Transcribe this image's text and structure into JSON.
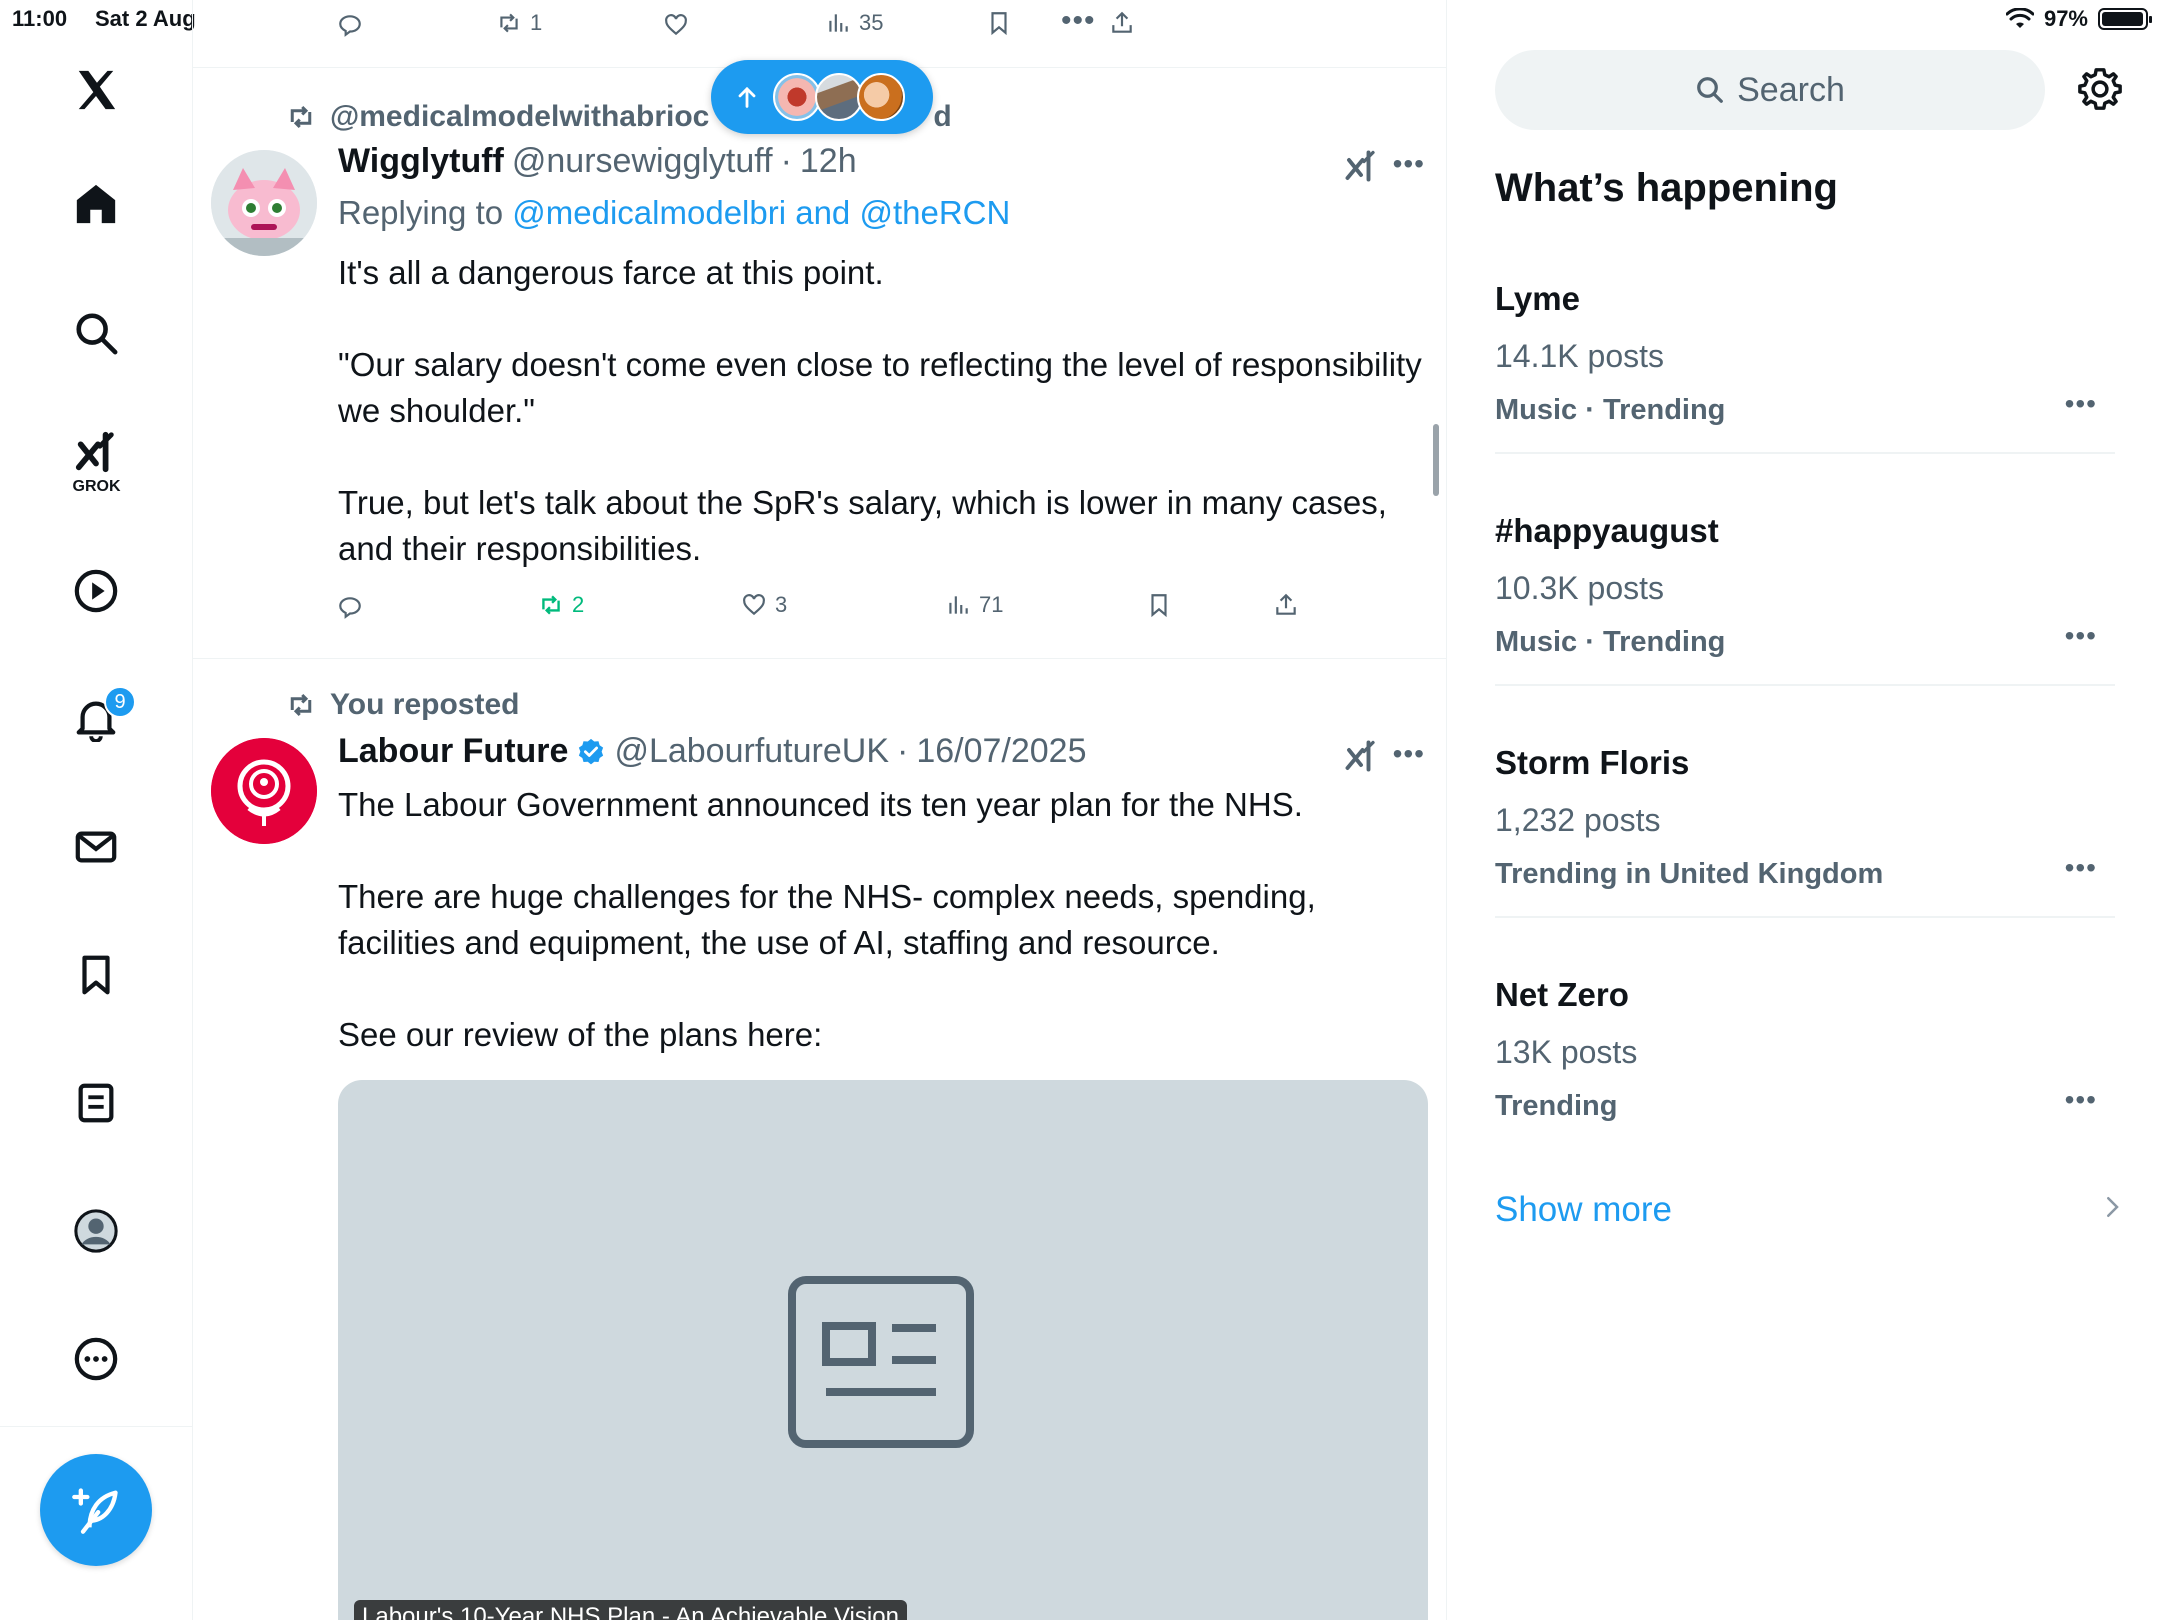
{
  "status_bar": {
    "time": "11:00",
    "date": "Sat 2 Aug",
    "battery": "97%",
    "battery_level": 0.97
  },
  "nav": {
    "grok_label": "GROK",
    "notifications_badge": "9",
    "items": [
      "x-logo",
      "home-icon",
      "search-icon",
      "grok-icon",
      "video-icon",
      "bell-icon",
      "mail-icon",
      "bookmark-icon",
      "lists-icon",
      "profile-icon",
      "more-icon"
    ]
  },
  "top_actions": {
    "reposts": "1",
    "views": "35"
  },
  "tweet1": {
    "repost_by": "@medicalmodelwithabrioc",
    "repost_suffix": "d",
    "name": "Wigglytuff",
    "handle": "@nursewigglytuff",
    "time": "12h",
    "replying_prefix": "Replying to",
    "replying_handles": "@medicalmodelbri and @theRCN",
    "body": [
      "It's all a dangerous farce at this point.",
      "\"Our salary doesn't come even close to reflecting the level of responsibility we shoulder.\"",
      "True, but let's talk about the SpR's salary, which is lower in many cases, and their responsibilities."
    ],
    "reposts": "2",
    "likes": "3",
    "views": "71"
  },
  "tweet2": {
    "repost_label": "You reposted",
    "name": "Labour Future",
    "handle": "@LabourfutureUK",
    "time": "16/07/2025",
    "body": [
      "The Labour Government announced its ten year plan for the NHS.",
      "There are huge challenges for the NHS- complex needs, spending, facilities and equipment, the use of AI, staffing and resource.",
      "See our review of the plans here:"
    ],
    "card_caption": "Labour's 10-Year NHS Plan - An Achievable Vision"
  },
  "sidebar": {
    "search_placeholder": "Search",
    "title": "What’s happening",
    "trends": [
      {
        "name": "Lyme",
        "count": "14.1K posts",
        "category": "Music · Trending"
      },
      {
        "name": "#happyaugust",
        "count": "10.3K posts",
        "category": "Music · Trending"
      },
      {
        "name": "Storm Floris",
        "count": "1,232 posts",
        "category": "Trending in United Kingdom"
      },
      {
        "name": "Net Zero",
        "count": "13K posts",
        "category": "Trending"
      }
    ],
    "show_more": "Show more"
  },
  "colors": {
    "accent": "#1d9bf0",
    "repost_green": "#00ba7c",
    "muted": "#536471",
    "labour_red": "#e4003b"
  }
}
